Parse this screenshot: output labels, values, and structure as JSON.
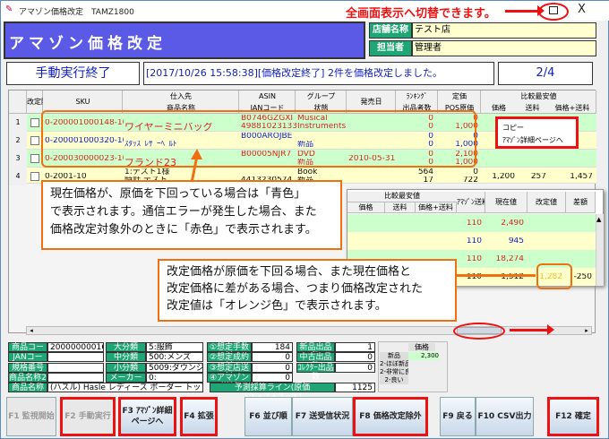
{
  "window": {
    "title": "アマゾン価格改定　TAMZ1800",
    "hint": "全画面表示へ切替できます。",
    "maximize": "□",
    "close": "X"
  },
  "header": {
    "title": "アマゾン価格改定",
    "store_label": "店舗名称",
    "store_value": "テスト店",
    "staff_label": "担当者",
    "staff_value": "管理者"
  },
  "status": {
    "state": "手動実行終了",
    "message": "[2017/10/26 15:58:38][価格改定終了] 2件を価格改定しました。",
    "page": "2/4"
  },
  "grid": {
    "headers": {
      "exclude": "改定除外",
      "sku": "SKU",
      "supplier": "仕入先",
      "name": "商品名称",
      "asin": "ASIN",
      "jan": "JANコード",
      "group": "グループ",
      "condition": "状態",
      "release": "発売日",
      "ranking": "ﾗﾝｷﾝｸﾞ",
      "sellers": "出品者数",
      "list_price": "定価",
      "pos_cost": "POS原価",
      "compare": "比較最安値",
      "price": "価格",
      "shipping": "送料",
      "total": "価格+送料",
      "amazon_ship": "ｱﾏｿﾞﾝ送料",
      "current": "現在値",
      "revised": "改定値",
      "diff": "差額"
    },
    "rows": [
      {
        "no": "1",
        "sku": "0-200001000148-10",
        "supplier": "",
        "name": "ワイヤーミニバッグ",
        "asin": "B0746GZGXI",
        "jan": "4988102313395",
        "group": "Musical",
        "condition": "Instruments",
        "release": "",
        "ranking": "0",
        "sellers": "0",
        "list_price": "0",
        "pos_cost": "1,000",
        "price": "",
        "shipping": "",
        "total": "",
        "amazon_ship": "110",
        "current": "2,490",
        "revised": "",
        "diff": "",
        "color": "#e02020",
        "bg": "#ccffcc"
      },
      {
        "no": "2",
        "sku": "0-200001000320-10",
        "supplier": "",
        "name": "ｽﾀｯｽﾞﾚｻﾞｰﾍﾞﾙﾄ",
        "asin": "B000AROJBE",
        "jan": "",
        "group": "",
        "condition": "新品",
        "release": "",
        "ranking": "0",
        "sellers": "0",
        "list_price": "0",
        "pos_cost": "1,000",
        "price": "",
        "shipping": "",
        "total": "",
        "amazon_ship": "110",
        "current": "945",
        "revised": "",
        "diff": "",
        "color": "#1020d0",
        "bg": "#ffffcc"
      },
      {
        "no": "3",
        "sku": "0-200030000023-10",
        "supplier": "",
        "name": "ブランド23",
        "asin": "B00005NJR7",
        "jan": "",
        "group": "DVD",
        "condition": "新品",
        "release": "2010-05-31",
        "ranking": "0",
        "sellers": "0",
        "list_price": "2,100",
        "pos_cost": "1,000",
        "price": "",
        "shipping": "",
        "total": "",
        "amazon_ship": "110",
        "current": "18,274",
        "revised": "",
        "diff": "",
        "color": "#e02020",
        "bg": "#ccffcc"
      },
      {
        "no": "4",
        "sku": "0-2001-10",
        "supplier": "1:テスト1様",
        "name": "時計 テスト",
        "asin": "",
        "jan": "4413230574",
        "group": "Book",
        "condition": "新品",
        "release": "",
        "ranking": "564",
        "sellers": "17",
        "list_price": "0",
        "pos_cost": "722",
        "price": "1,200",
        "shipping": "257",
        "total": "1,457",
        "amazon_ship": "110",
        "current": "1,512",
        "revised": "1,282",
        "diff": "-250",
        "color": "#111111",
        "bg": "#ffffcc"
      }
    ]
  },
  "context_menu": [
    "コピー",
    "ｱﾏｿﾞﾝ詳細ページへ"
  ],
  "callouts": {
    "first": [
      "現在価格が、原価を下回っている場合は「青色」",
      "で表示されます。通信エラーが発生した場合、また",
      "価格改定対象外のときに「赤色」で表示されます。"
    ],
    "second": [
      "改定価格が原価を下回る場合、また現在価格と",
      "改定価格に差がある場合、つまり価格改定された",
      "改定値は「オレンジ色」で表示されます。"
    ]
  },
  "info": {
    "col1": [
      {
        "label": "商品コード",
        "value": "200000000168"
      },
      {
        "label": "JANコード",
        "value": ""
      },
      {
        "label": "規格番号",
        "value": ""
      },
      {
        "label": "商品名称2",
        "value": ""
      }
    ],
    "col2": [
      {
        "label": "大分類",
        "value": "5:服飾"
      },
      {
        "label": "中分類",
        "value": "500:メンズ"
      },
      {
        "label": "小分類",
        "value": "5009:ダウンジ..."
      },
      {
        "label": "メーカー",
        "value": "0:"
      }
    ],
    "col3": [
      {
        "label": "①想定手数料",
        "value": "184"
      },
      {
        "label": "②想定成約料",
        "value": "0"
      },
      {
        "label": "③想定店送料",
        "value": "0"
      },
      {
        "label": "④アマゾン送料",
        "value": "0"
      }
    ],
    "col4": [
      {
        "label": "新品出品数",
        "value": "1"
      },
      {
        "label": "中古出品数",
        "value": "0"
      },
      {
        "label": "ｺﾚｸﾀｰ出品数",
        "value": "0"
      }
    ],
    "name_label": "商品名称",
    "name_value": "(ハスル) Hasle レディース ボーダー トップス ...",
    "forecast_label": "予測採算ライン(原価+①+②+③−④)",
    "forecast_value": "1125",
    "mini": {
      "header": "価格",
      "rows": [
        {
          "label": "新品",
          "value": "2,300"
        },
        {
          "label": "2-ほぼ新品",
          "value": ""
        },
        {
          "label": "2-非常に良い",
          "value": ""
        },
        {
          "label": "2-良い",
          "value": ""
        }
      ]
    }
  },
  "buttons": [
    {
      "id": "f1",
      "label": "F1 監視開始"
    },
    {
      "id": "f2",
      "label": "F2 手動実行"
    },
    {
      "id": "f3",
      "label": "F3 ｱﾏｿﾞﾝ詳細ページへ"
    },
    {
      "id": "f4",
      "label": "F4 拡張"
    },
    {
      "id": "f6",
      "label": "F6 並び順"
    },
    {
      "id": "f7",
      "label": "F7 送受信状況"
    },
    {
      "id": "f8",
      "label": "F8 価格改定除外"
    },
    {
      "id": "f9",
      "label": "F9 戻る"
    },
    {
      "id": "f10",
      "label": "F10 CSV出力"
    },
    {
      "id": "f12",
      "label": "F12 確定"
    }
  ],
  "colors": {
    "header_bg": "#5a5ae6",
    "label_green": "#1fa676",
    "row_green": "#ccffcc",
    "row_yellow": "#ffffcc",
    "error_red": "#e02020",
    "below_cost_blue": "#1020d0",
    "revised_orange": "#f0c020",
    "highlight_red": "#ee1111"
  }
}
